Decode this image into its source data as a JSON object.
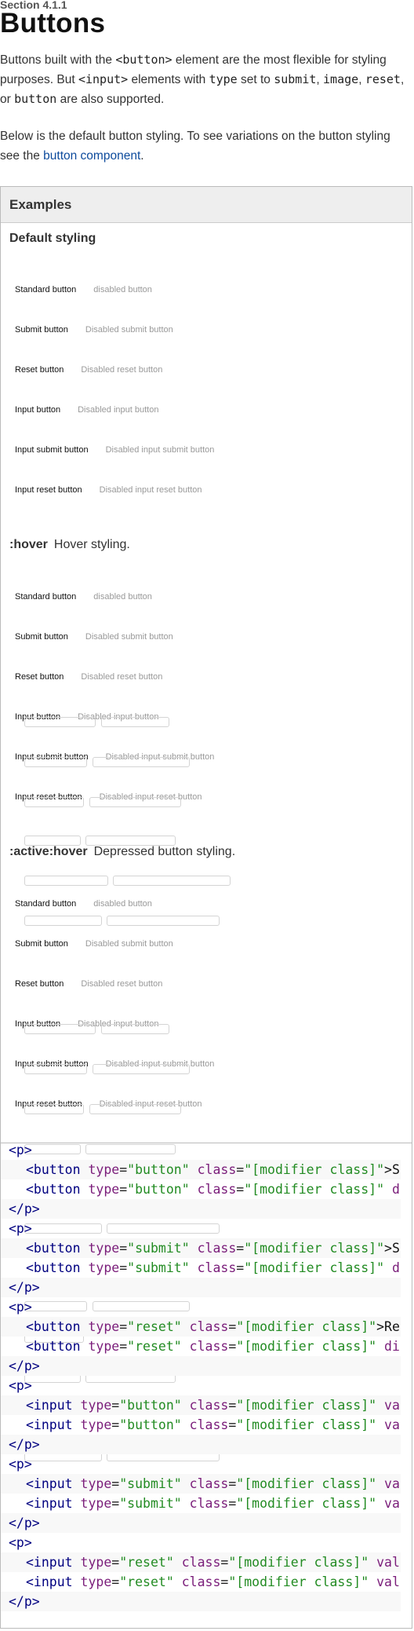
{
  "section_label": "Section 4.1.1",
  "title": "Buttons",
  "intro": {
    "p1_a": "Buttons built with the ",
    "p1_code1": "<button>",
    "p1_b": " element are the most flexible for styling purposes. But ",
    "p1_code2": "<input>",
    "p1_c": " elements with ",
    "p1_code3": "type",
    "p1_d": " set to ",
    "p1_code4": "submit",
    "p1_e": ", ",
    "p1_code5": "image",
    "p1_f": ", ",
    "p1_code6": "reset",
    "p1_g": ", or ",
    "p1_code7": "button",
    "p1_h": " are also supported.",
    "p2_a": "Below is the default button styling. To see variations on the button styling see the ",
    "p2_link": "button component",
    "p2_b": "."
  },
  "examples": {
    "header": "Examples",
    "default_heading": "Default styling",
    "hover_state": ":hover",
    "hover_desc": "Hover styling.",
    "active_state": ":active:hover",
    "active_desc": "Depressed button styling.",
    "rows": [
      {
        "enabled": "Standard button",
        "disabled": "disabled button"
      },
      {
        "enabled": "Submit button",
        "disabled": "Disabled submit button"
      },
      {
        "enabled": "Reset button",
        "disabled": "Disabled reset button"
      },
      {
        "enabled": "Input button",
        "disabled": "Disabled input button"
      },
      {
        "enabled": "Input submit button",
        "disabled": "Disabled input submit button"
      },
      {
        "enabled": "Input reset button",
        "disabled": "Disabled input reset button"
      }
    ]
  },
  "code": {
    "p_open": "<p>",
    "p_close": "</p>",
    "tag_button": "<button",
    "tag_input": "<input",
    "attr_type": "type",
    "attr_class": "class",
    "eq": "=",
    "val_button": "\"button\"",
    "val_submit": "\"submit\"",
    "val_reset": "\"reset\"",
    "val_class": "\"[modifier class]\"",
    "tails": {
      "b1": ">S",
      "b2": " d",
      "s1": ">S",
      "s2": " d",
      "r1": ">Re",
      "r2": " di",
      "i1": " va",
      "i2": " va",
      "is1": " va",
      "is2": " va",
      "ir1": " val",
      "ir2": " val"
    }
  }
}
